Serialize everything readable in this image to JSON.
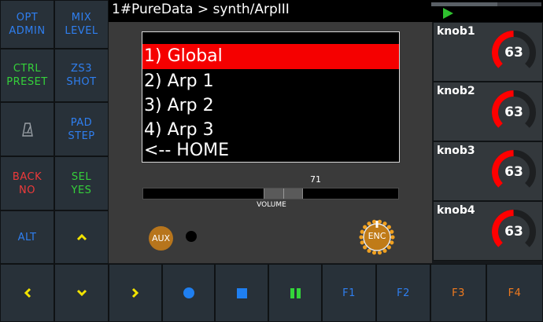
{
  "app": {
    "title": "1#PureData > synth/ArpIII",
    "progress": 0.6
  },
  "left_buttons": {
    "opt_admin": [
      "OPT",
      "ADMIN"
    ],
    "mix_level": [
      "MIX",
      "LEVEL"
    ],
    "ctrl_preset": [
      "CTRL",
      "PRESET"
    ],
    "zs3_shot": [
      "ZS3",
      "SHOT"
    ],
    "metronome_icon": "metronome-icon",
    "pad_step": [
      "PAD",
      "STEP"
    ],
    "back_no": [
      "BACK",
      "NO"
    ],
    "sel_yes": [
      "SEL",
      "YES"
    ],
    "alt": "ALT",
    "up_icon": "chevron-up-icon"
  },
  "menu": {
    "items": [
      "1) Global",
      "2) Arp 1",
      "3) Arp 2",
      "4) Arp 3",
      "<-- HOME"
    ],
    "selected_index": 0
  },
  "volume": {
    "value": "71",
    "label": "VOLUME",
    "min": 0,
    "max": 127
  },
  "controls": {
    "aux_label": "AUX",
    "enc_label": "ENC"
  },
  "knobs": [
    {
      "label": "knob1",
      "value": "63"
    },
    {
      "label": "knob2",
      "value": "63"
    },
    {
      "label": "knob3",
      "value": "63"
    },
    {
      "label": "knob4",
      "value": "63"
    }
  ],
  "bottom_buttons": {
    "left_icon": "chevron-left-icon",
    "down_icon": "chevron-down-icon",
    "right_icon": "chevron-right-icon",
    "record_icon": "record-icon",
    "stop_icon": "stop-icon",
    "pause_icon": "pause-icon",
    "f1": "F1",
    "f2": "F2",
    "f3": "F3",
    "f4": "F4"
  },
  "colors": {
    "accent_red": "#f50000",
    "blue": "#2f7ff0",
    "green": "#35d13a",
    "yellow": "#f2e300",
    "orange": "#f07a1e"
  }
}
